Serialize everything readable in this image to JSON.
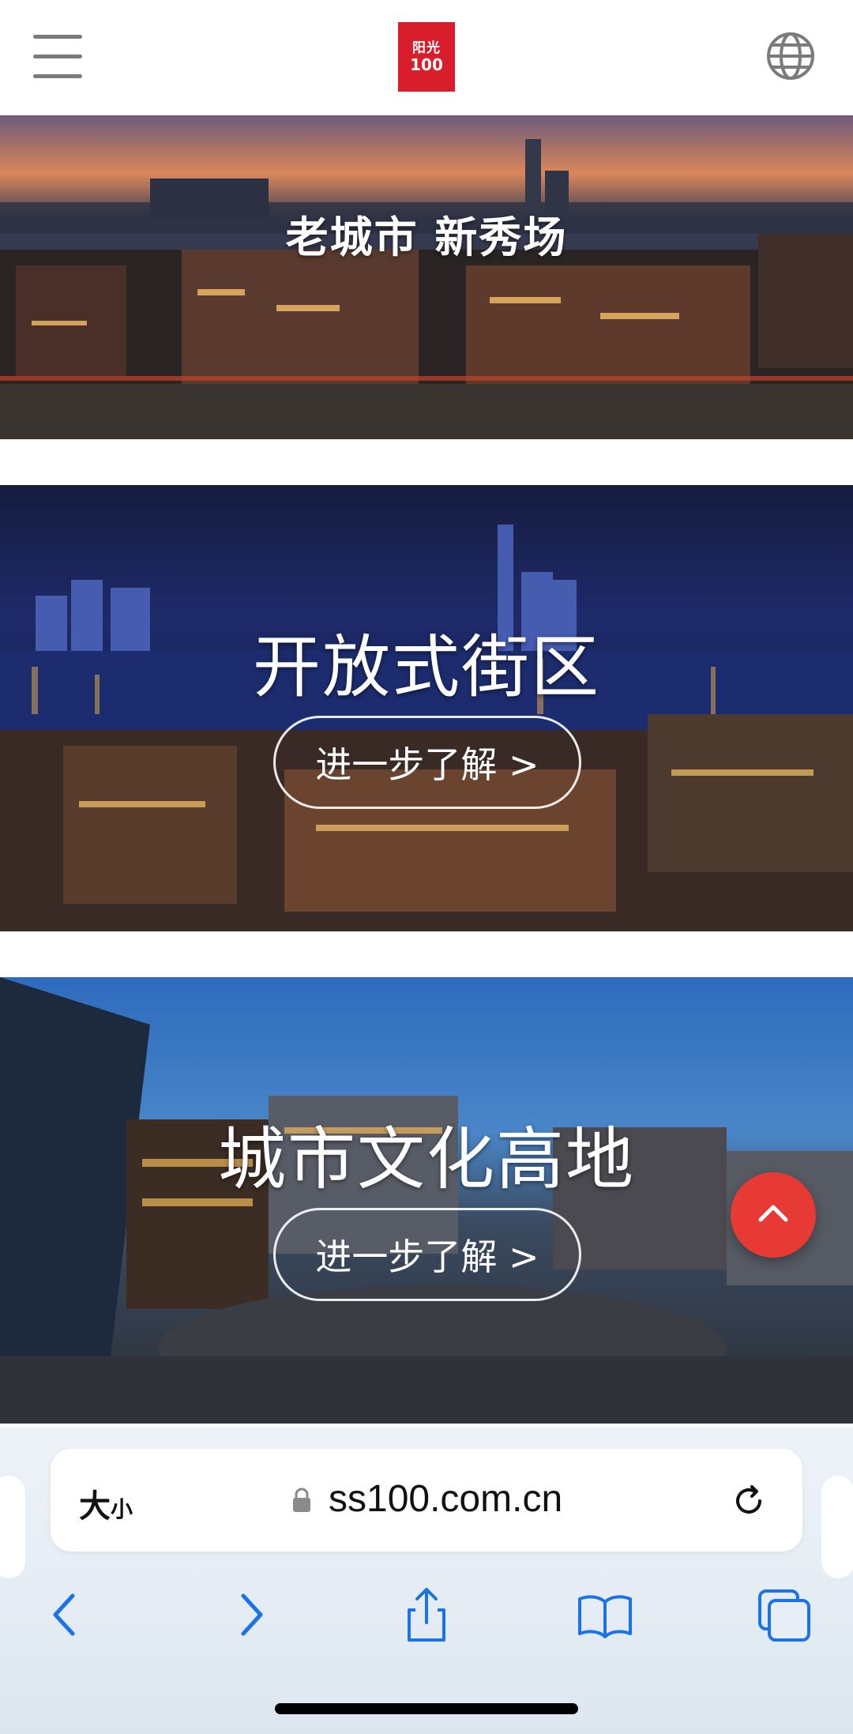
{
  "header": {
    "menu_icon": "hamburger-icon",
    "logo_text_top": "阳光",
    "logo_text_bottom": "100",
    "language_icon": "globe-icon"
  },
  "banners": [
    {
      "title": "老城市 新秀场",
      "cta": ""
    },
    {
      "title": "开放式街区",
      "cta": "进一步了解 >"
    },
    {
      "title": "城市文化高地",
      "cta": "进一步了解 >"
    }
  ],
  "back_to_top_icon": "chevron-up-icon",
  "browser": {
    "text_size_label_big": "大",
    "text_size_label_small": "小",
    "url": "ss100.com.cn",
    "lock_icon": "lock-icon",
    "reload_icon": "reload-icon",
    "toolbar": [
      "back-icon",
      "forward-icon",
      "share-icon",
      "bookmarks-icon",
      "tabs-icon"
    ]
  },
  "colors": {
    "brand_red": "#d81e2b",
    "fab_red": "#e83a35",
    "safari_blue": "#1a73e8"
  }
}
